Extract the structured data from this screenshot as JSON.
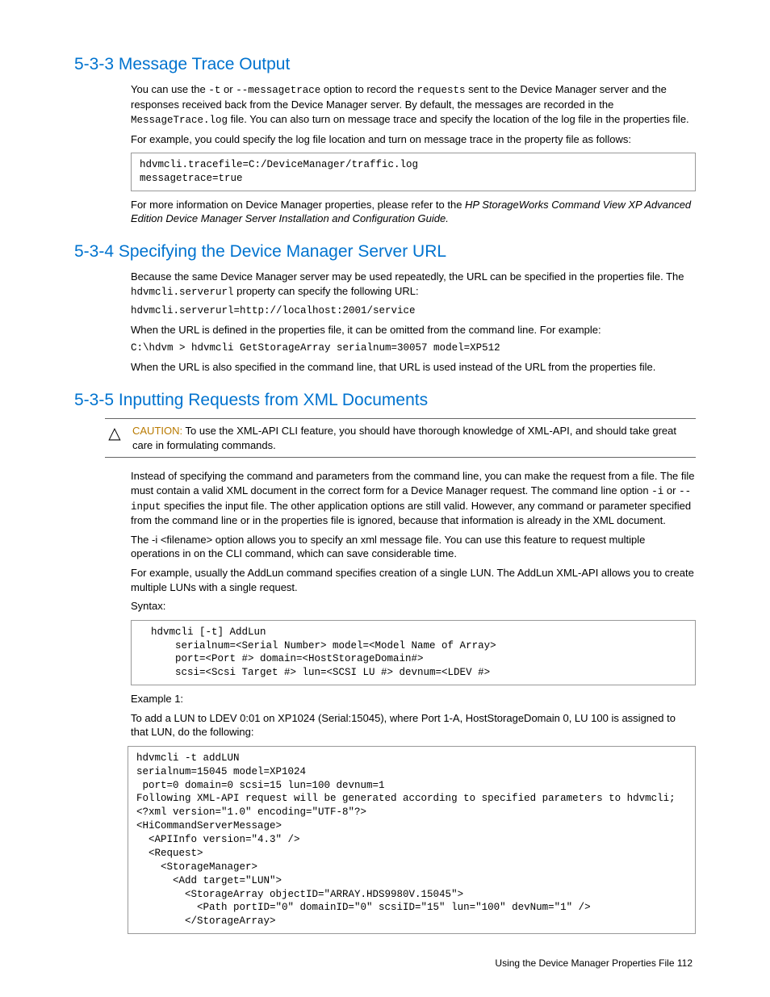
{
  "h533": {
    "title": "5-3-3 Message Trace Output",
    "p1a": "You can use the ",
    "p1b": "-t",
    "p1c": " or ",
    "p1d": "--messagetrace",
    "p1e": " option to record the ",
    "p1f": "requests",
    "p1g": " sent to the Device Manager server and the responses received back from the Device Manager server. By default, the messages are recorded in the ",
    "p1h": "MessageTrace.log",
    "p1i": " file. You can also turn on message trace and specify the location of the log file in the properties file.",
    "p2": "For example, you could specify the log file location and turn on message trace in the property file as follows:",
    "code1": "hdvmcli.tracefile=C:/DeviceManager/traffic.log\nmessagetrace=true",
    "p3a": "For more information on Device Manager properties, please refer to the ",
    "p3b": "HP StorageWorks Command View XP Advanced Edition Device Manager Server Installation and Configuration Guide."
  },
  "h534": {
    "title": "5-3-4 Specifying the Device Manager Server URL",
    "p1a": "Because the same Device Manager server may be used repeatedly, the URL can be specified in the properties file. The ",
    "p1b": "hdvmcli.serverurl",
    "p1c": " property can specify the following URL:",
    "code1": "hdvmcli.serverurl=http://localhost:2001/service",
    "p2": "When the URL is defined in the properties file, it can be omitted from the command line. For example:",
    "code2": "C:\\hdvm > hdvmcli GetStorageArray serialnum=30057 model=XP512",
    "p3": "When the URL is also specified in the command line, that URL is used instead of the URL from the properties file."
  },
  "h535": {
    "title": "5-3-5 Inputting Requests from XML Documents",
    "caution_label": "CAUTION:",
    "caution_text": "  To use the XML-API CLI feature, you should have thorough knowledge of XML-API, and should take great care in formulating commands.",
    "p1a": "Instead of specifying the command and parameters from the command line, you can make the request from a file. The file must contain a valid XML document in the correct form for a Device Manager request. The command line option ",
    "p1b": "-i",
    "p1c": " or ",
    "p1d": "--input",
    "p1e": " specifies the input file. The other application options are still valid. However, any command or parameter specified from the command line or in the properties file is ignored, because that information is already in the XML document.",
    "p2": "The -i <filename> option allows you to specify an xml message file. You can use this feature to request multiple operations in on the CLI command, which can save considerable time.",
    "p3": "For example, usually the AddLun command specifies creation of a single LUN. The AddLun XML-API allows you to create multiple LUNs with a single request.",
    "p4": "Syntax:",
    "code1": "hdvmcli [-t] AddLun\n    serialnum=<Serial Number> model=<Model Name of Array>\n    port=<Port #> domain=<HostStorageDomain#>\n    scsi=<Scsi Target #> lun=<SCSI LU #> devnum=<LDEV #>",
    "p5": "Example 1:",
    "p6": "To add a LUN to LDEV 0:01 on XP1024 (Serial:15045), where Port 1-A, HostStorageDomain 0, LU 100 is assigned to that LUN, do the following:",
    "code2": "hdvmcli -t addLUN\nserialnum=15045 model=XP1024\n port=0 domain=0 scsi=15 lun=100 devnum=1\nFollowing XML-API request will be generated according to specified parameters to hdvmcli;\n<?xml version=\"1.0\" encoding=\"UTF-8\"?>\n<HiCommandServerMessage>\n  <APIInfo version=\"4.3\" />\n  <Request>\n    <StorageManager>\n      <Add target=\"LUN\">\n        <StorageArray objectID=\"ARRAY.HDS9980V.15045\">\n          <Path portID=\"0\" domainID=\"0\" scsiID=\"15\" lun=\"100\" devNum=\"1\" />\n        </StorageArray>"
  },
  "footer": "Using the Device Manager Properties File   112"
}
